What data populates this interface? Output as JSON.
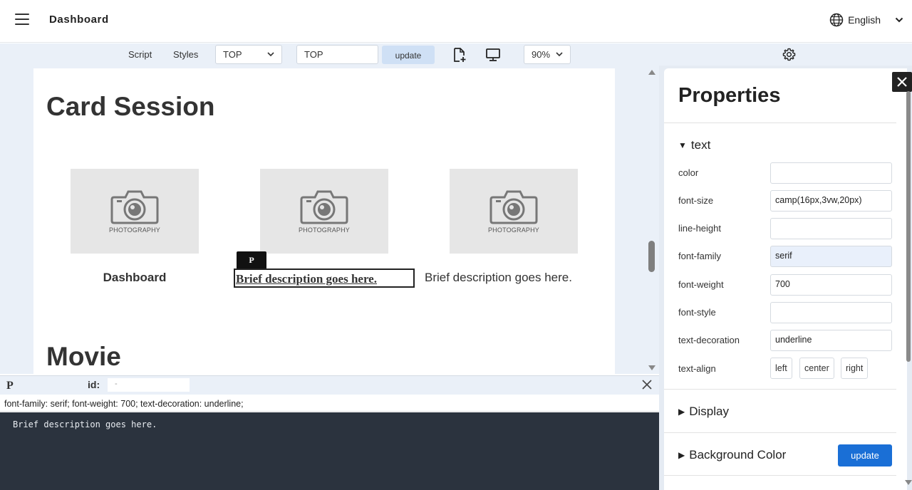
{
  "header": {
    "title": "Dashboard",
    "language": "English"
  },
  "toolbar": {
    "script_label": "Script",
    "styles_label": "Styles",
    "page_select": "TOP",
    "page_input": "TOP",
    "update_label": "update",
    "zoom_select": "90%"
  },
  "canvas": {
    "heading_card": "Card Session",
    "heading_movie": "Movie",
    "cards": [
      {
        "image_caption": "PHOTOGRAPHY",
        "text": "Dashboard"
      },
      {
        "image_caption": "PHOTOGRAPHY",
        "text": "Brief description goes here."
      },
      {
        "image_caption": "PHOTOGRAPHY",
        "text": "Brief description goes here."
      }
    ],
    "selected_tag": "P"
  },
  "bottom": {
    "tag": "P",
    "id_label": "id:",
    "id_value": "-",
    "style_line": "font-family: serif; font-weight: 700; text-decoration: underline;",
    "code_content": "Brief description goes here."
  },
  "properties": {
    "title": "Properties",
    "sections": {
      "text": "text",
      "display": "Display",
      "background": "Background Color"
    },
    "rows": [
      {
        "label": "color",
        "value": ""
      },
      {
        "label": "font-size",
        "value": "camp(16px,3vw,20px)"
      },
      {
        "label": "line-height",
        "value": ""
      },
      {
        "label": "font-family",
        "value": "serif"
      },
      {
        "label": "font-weight",
        "value": "700"
      },
      {
        "label": "font-style",
        "value": ""
      },
      {
        "label": "text-decoration",
        "value": "underline"
      }
    ],
    "align_label": "text-align",
    "align_options": [
      "left",
      "center",
      "right"
    ],
    "update_label": "update"
  },
  "colors": {
    "accent": "#1a6fd6",
    "toolbar_bg": "#eaf0f8",
    "code_bg": "#2b333e"
  }
}
